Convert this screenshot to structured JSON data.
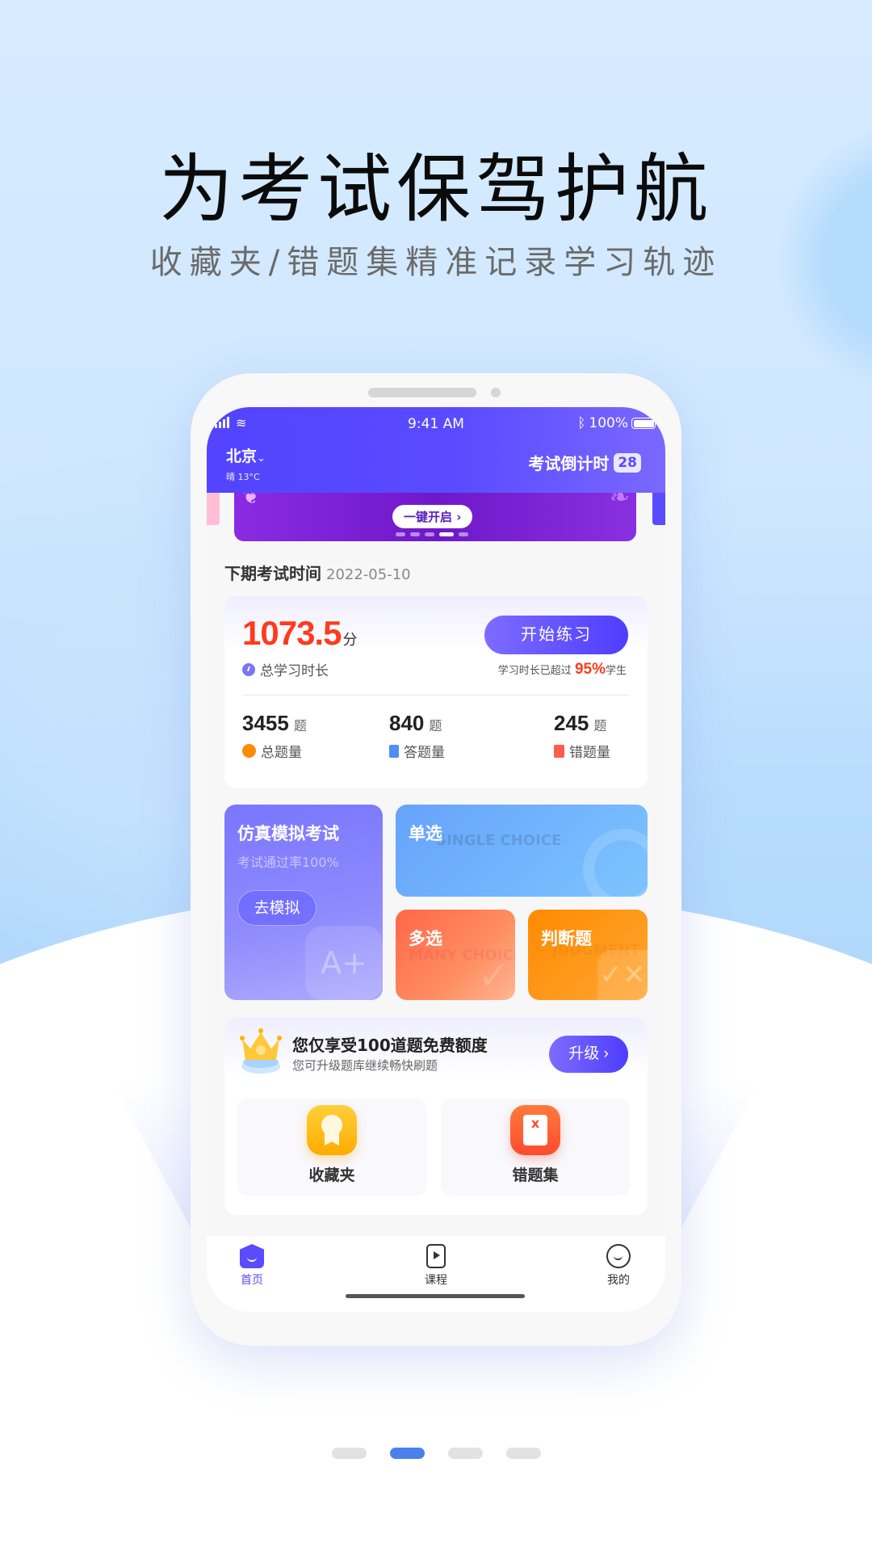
{
  "promo": {
    "headline": "为考试保驾护航",
    "subline": "收藏夹/错题集精准记录学习轨迹"
  },
  "status_bar": {
    "time": "9:41 AM",
    "battery": "100%"
  },
  "header": {
    "city": "北京",
    "weather": "晴 13°C",
    "countdown_label": "考试倒计时",
    "countdown_days": "28"
  },
  "banner": {
    "cta": "一键开启 ›",
    "slide_count": 5,
    "active_slide": 4
  },
  "next_exam": {
    "label": "下期考试时间",
    "date": "2022-05-10"
  },
  "stats": {
    "score": "1073.5",
    "score_unit": "分",
    "duration_label": "总学习时长",
    "start_button": "开始练习",
    "exceed_prefix": "学习时长已超过",
    "exceed_percent": "95%",
    "exceed_suffix": "学生",
    "items": [
      {
        "num": "3455",
        "unit": "题",
        "label": "总题量",
        "icon": "pie-chart-icon"
      },
      {
        "num": "840",
        "unit": "题",
        "label": "答题量",
        "icon": "book-icon"
      },
      {
        "num": "245",
        "unit": "题",
        "label": "错题量",
        "icon": "error-book-icon"
      }
    ]
  },
  "tiles": {
    "simulation": {
      "title": "仿真模拟考试",
      "subtitle": "考试通过率100%",
      "button": "去模拟"
    },
    "single": {
      "title": "单选",
      "ghost": "SINGLE CHOICE"
    },
    "multi": {
      "title": "多选",
      "ghost": "MANY CHOICE"
    },
    "judge": {
      "title": "判断题",
      "ghost": "JUDGMENT"
    }
  },
  "vip": {
    "title": "您仅享受100道题免费额度",
    "desc": "您可升级题库继续畅快刷题",
    "button": "升级 ›",
    "shortcuts": [
      {
        "label": "收藏夹",
        "icon": "favorites-medal-icon"
      },
      {
        "label": "错题集",
        "icon": "wrong-questions-icon"
      }
    ]
  },
  "tabbar": {
    "items": [
      {
        "label": "首页",
        "active": true
      },
      {
        "label": "课程",
        "active": false
      },
      {
        "label": "我的",
        "active": false
      }
    ]
  },
  "pager": {
    "count": 4,
    "active": 2
  },
  "colors": {
    "brand_purple": "#5a4bff",
    "accent_red": "#ff3a1e",
    "pager_active": "#4a80ea"
  }
}
